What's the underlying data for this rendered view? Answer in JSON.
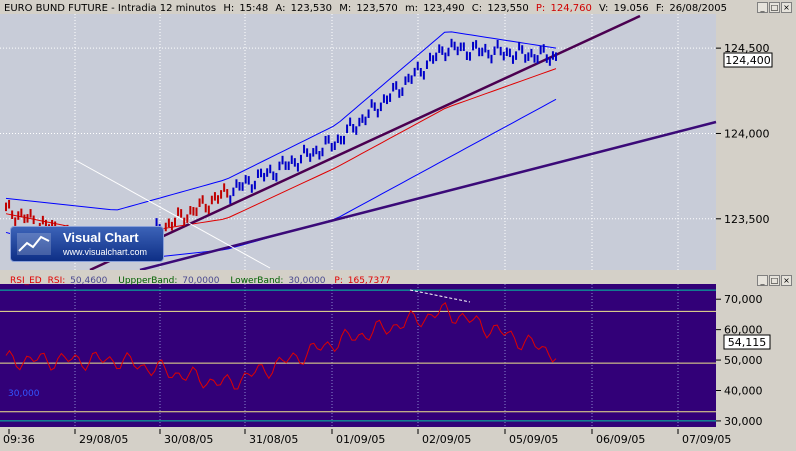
{
  "header": {
    "title": "EURO BUND FUTURE - Intradia 12 minutos",
    "h_label": "H:",
    "h_value": "15:48",
    "a_label": "A:",
    "a_value": "123,530",
    "m_label": "M:",
    "m_value": "123,570",
    "mi_label": "m:",
    "mi_value": "123,490",
    "c_label": "C:",
    "c_value": "123,550",
    "p_label": "P:",
    "p_value": "124,760",
    "v_label": "V:",
    "v_value": "19.056",
    "f_label": "F:",
    "f_value": "26/08/2005"
  },
  "logo": {
    "name": "Visual Chart",
    "url": "www.visualchart.com"
  },
  "rsi_header": {
    "rsi_label": "RSI_ED",
    "rsi_name": "RSI:",
    "rsi_value": "50,4600",
    "upper_label": "UppperBand:",
    "upper_value": "70,0000",
    "lower_label": "LowerBand:",
    "lower_value": "30,0000",
    "p_label": "P:",
    "p_value": "165,7377"
  },
  "price_axis": {
    "ticks": [
      "124,500",
      "124,000",
      "123,500"
    ],
    "current_badge": "124,400"
  },
  "rsi_axis": {
    "ticks": [
      "70,000",
      "60,000",
      "50,000",
      "40,000",
      "30,000"
    ],
    "current_badge": "54,115",
    "left_label": "30,000"
  },
  "x_axis": {
    "ticks": [
      "09:36",
      "29/08/05",
      "30/08/05",
      "31/08/05",
      "01/09/05",
      "02/09/05",
      "05/09/05",
      "06/09/05",
      "07/09/05"
    ]
  },
  "colors": {
    "price_bg": "#c8ccd8",
    "rsi_bg": "#320078",
    "price_bars": "#0000c8",
    "bollinger": "#0000ff",
    "moving_average": "#e00000",
    "trendline": "#4b0050",
    "rsi_line": "#e00000",
    "band_upper": "#f0e68c",
    "band_green": "#00c8a0"
  },
  "chart_data": [
    {
      "type": "line",
      "title": "EURO BUND FUTURE - Intradia 12 minutos",
      "x": [
        "29/08/05",
        "30/08/05",
        "31/08/05",
        "01/09/05",
        "02/09/05",
        "05/09/05",
        "06/09/05",
        "07/09/05"
      ],
      "ylim": [
        123.2,
        124.7
      ],
      "series": [
        {
          "name": "Price",
          "values": [
            123.55,
            123.3,
            123.65,
            123.95,
            124.5,
            124.45
          ]
        },
        {
          "name": "Bollinger Upper",
          "values": [
            123.62,
            123.55,
            123.73,
            124.05,
            124.6,
            124.5
          ]
        },
        {
          "name": "Bollinger Lower",
          "values": [
            123.42,
            123.25,
            123.32,
            123.5,
            123.85,
            124.2
          ]
        },
        {
          "name": "Moving Average",
          "values": [
            123.53,
            123.4,
            123.5,
            123.8,
            124.15,
            124.38
          ]
        }
      ]
    },
    {
      "type": "line",
      "title": "RSI_ED",
      "x": [
        "29/08/05",
        "30/08/05",
        "31/08/05",
        "01/09/05",
        "02/09/05",
        "05/09/05"
      ],
      "ylim": [
        28,
        75
      ],
      "series": [
        {
          "name": "RSI",
          "values": [
            50,
            50,
            42,
            56,
            66,
            52
          ]
        }
      ]
    }
  ]
}
